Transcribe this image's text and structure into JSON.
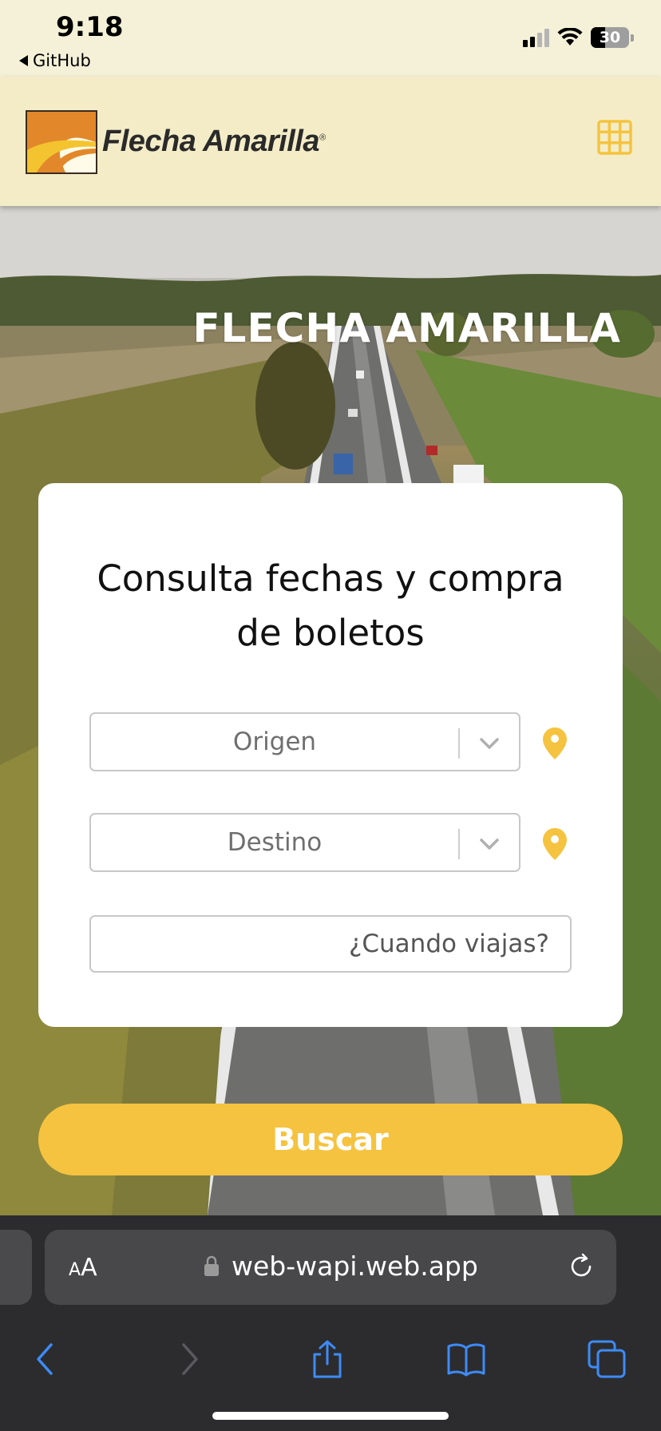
{
  "status_bar": {
    "time": "9:18",
    "back_label": "GitHub",
    "battery_percent": "30",
    "icons": [
      "signal-icon",
      "wifi-icon",
      "battery-icon"
    ]
  },
  "header": {
    "logo_text": "Flecha Amarilla",
    "logo_mark": "®",
    "menu_icon": "grid-icon"
  },
  "hero": {
    "title": "FLECHA AMARILLA"
  },
  "search_form": {
    "title": "Consulta fechas y compra de boletos",
    "origin": {
      "placeholder": "Origen",
      "icon": "location-pin-icon"
    },
    "destination": {
      "placeholder": "Destino",
      "icon": "location-pin-icon"
    },
    "date": {
      "placeholder": "¿Cuando viajas?"
    },
    "submit_label": "Buscar"
  },
  "browser": {
    "text_size_label_small": "A",
    "text_size_label_big": "A",
    "url": "web-wapi.web.app",
    "toolbar": [
      "back-icon",
      "forward-icon",
      "share-icon",
      "bookmarks-icon",
      "tabs-icon"
    ]
  },
  "colors": {
    "accent": "#f5c33f",
    "header_bg": "#f3ecc7",
    "status_bg": "#f5f1d8",
    "toolbar_blue": "#3d8bf7",
    "browser_bg": "#2c2c2e"
  }
}
